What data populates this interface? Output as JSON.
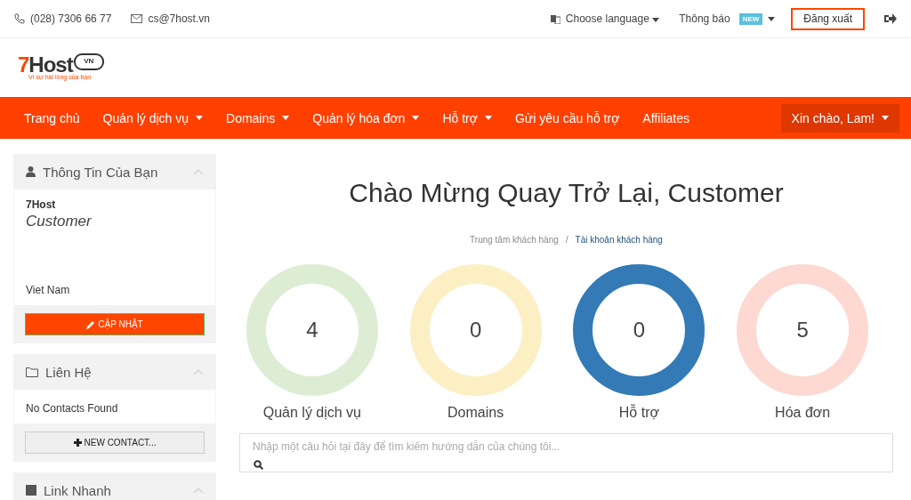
{
  "top_bar": {
    "phone": "(028) 7306 66 77",
    "email": "cs@7host.vn",
    "language": "Choose language",
    "notifications": {
      "label": "Thông báo",
      "badge": "NEW"
    },
    "logout_button": "Đăng xuất"
  },
  "logo": {
    "text": "7Host",
    "cloud_text": "VN",
    "tagline": "Vì sự hài lòng của bạn"
  },
  "nav": {
    "items": [
      {
        "label": "Trang chủ",
        "has_menu": false
      },
      {
        "label": "Quản lý dịch vụ",
        "has_menu": true
      },
      {
        "label": "Domains",
        "has_menu": true
      },
      {
        "label": "Quản lý hóa đơn",
        "has_menu": true
      },
      {
        "label": "Hỗ trợ",
        "has_menu": true
      },
      {
        "label": "Gửi yêu cầu hỗ trợ",
        "has_menu": false
      },
      {
        "label": "Affiliates",
        "has_menu": false
      }
    ],
    "account": {
      "label": "Xin chào, Lam!",
      "has_menu": true
    }
  },
  "sidebar": {
    "panels": [
      {
        "title": "Thông Tin Của Bạn",
        "lines": [
          {
            "kind": "name",
            "text": "7Host"
          },
          {
            "kind": "role",
            "text": "Customer"
          },
          {
            "kind": "spacer"
          },
          {
            "kind": "plain",
            "text": "Viet Nam"
          }
        ],
        "button": {
          "label": "CẬP NHẬT",
          "kind": "primary"
        }
      },
      {
        "title": "Liên Hệ",
        "lines": [
          {
            "kind": "plain",
            "text": "No Contacts Found"
          }
        ],
        "button": {
          "label": "NEW CONTACT...",
          "kind": "default"
        }
      },
      {
        "title": "Link Nhanh"
      }
    ]
  },
  "main": {
    "heading": "Chào Mừng Quay Trở Lại, Customer",
    "breadcrumb_separator": "/",
    "breadcrumb": [
      {
        "label": "Trung tâm khách hàng",
        "selected": false
      },
      {
        "label": "Tài khoản khách hàng",
        "selected": true
      }
    ],
    "stats": [
      {
        "count": "4",
        "label": "Quản lý dịch vụ",
        "color": "#dcedd3"
      },
      {
        "count": "0",
        "label": "Domains",
        "color": "#fcefc4"
      },
      {
        "count": "0",
        "label": "Hỗ trợ",
        "color": "#337ab7"
      },
      {
        "count": "5",
        "label": "Hóa đơn",
        "color": "#fdd9d1"
      }
    ],
    "search": {
      "placeholder": "Nhập một câu hỏi tại đây để tìm kiếm hướng dẫn của chúng tôi..."
    }
  }
}
